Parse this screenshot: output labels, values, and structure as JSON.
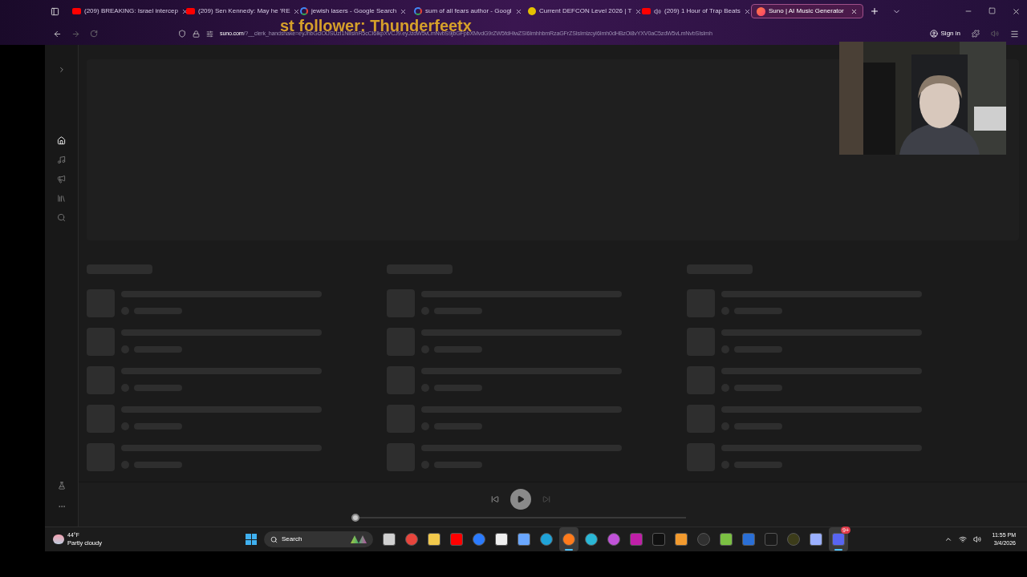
{
  "browser": {
    "tabs": [
      {
        "title": "(209) BREAKING: Israel intercep",
        "kind": "youtube",
        "selected": false,
        "audio": false
      },
      {
        "title": "(209) Sen Kennedy: May he 'RE",
        "kind": "youtube",
        "selected": false,
        "audio": false
      },
      {
        "title": "jewish lasers - Google Search",
        "kind": "google",
        "selected": false,
        "audio": false
      },
      {
        "title": "sum of all fears author - Googl",
        "kind": "google",
        "selected": false,
        "audio": false
      },
      {
        "title": "Current DEFCON Level 2026 | T",
        "kind": "hazard",
        "selected": false,
        "audio": false
      },
      {
        "title": "(209) 1 Hour of Trap Beats",
        "kind": "youtube",
        "selected": false,
        "audio": true
      },
      {
        "title": "Suno | AI Music Generator",
        "kind": "suno",
        "selected": true,
        "audio": false
      }
    ],
    "url_host": "suno.com",
    "url_path": "/?__clerk_handshake=eyJhbGciOiJSUzI1NiIsInR5cCI6IkpXVCJ9.eyJzdW5vLmNvbS9jbGFpbXMvdG9rZW5fdHlwZSI6ImhhbmRzaGFrZSIsImlzcyI6Imh0dHBzOi8vYXV0aC5zdW5vLmNvbSIsImh",
    "sign_in": "Sign in"
  },
  "overlay_text": "st follower: Thunderfeetx",
  "sidebar": {
    "items": [
      {
        "kind": "home",
        "selected": true
      },
      {
        "kind": "music",
        "selected": false
      },
      {
        "kind": "megaphone",
        "selected": false
      },
      {
        "kind": "library",
        "selected": false
      },
      {
        "kind": "search",
        "selected": false
      }
    ],
    "bottom": [
      {
        "kind": "flask"
      },
      {
        "kind": "more"
      }
    ]
  },
  "player": {
    "level": 0
  },
  "taskbar": {
    "temperature": "44°F",
    "weather": "Partly cloudy",
    "search": "Search",
    "apps": [
      {
        "kind": "taskview",
        "selected": false
      },
      {
        "kind": "chrome",
        "selected": false
      },
      {
        "kind": "folder",
        "selected": false
      },
      {
        "kind": "youtube",
        "selected": false
      },
      {
        "kind": "messenger",
        "selected": false
      },
      {
        "kind": "store",
        "selected": false
      },
      {
        "kind": "copilot",
        "selected": false
      },
      {
        "kind": "edge",
        "selected": false
      },
      {
        "kind": "firefox",
        "selected": true
      },
      {
        "kind": "canva",
        "selected": false
      },
      {
        "kind": "palm",
        "selected": false
      },
      {
        "kind": "picsart",
        "selected": false
      },
      {
        "kind": "wave",
        "selected": false
      },
      {
        "kind": "fox",
        "selected": false
      },
      {
        "kind": "obs",
        "selected": false
      },
      {
        "kind": "leaf",
        "selected": false
      },
      {
        "kind": "scan",
        "selected": false
      },
      {
        "kind": "tree",
        "selected": false
      },
      {
        "kind": "globe",
        "selected": false
      },
      {
        "kind": "cursor",
        "selected": false
      },
      {
        "kind": "discord",
        "selected": true,
        "badge": "9+"
      }
    ],
    "time": "11:55 PM",
    "date": "3/4/2026"
  }
}
